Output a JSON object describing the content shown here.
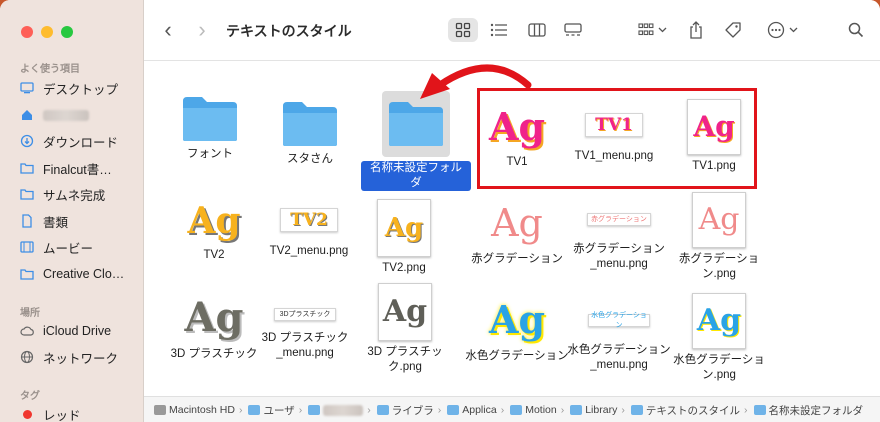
{
  "window": {
    "title": "テキストのスタイル"
  },
  "sidebar": {
    "favorites_title": "よく使う項目",
    "items": [
      {
        "label": "デスクトップ",
        "icon": "desktop-icon"
      },
      {
        "label": "",
        "icon": "home-icon"
      },
      {
        "label": "ダウンロード",
        "icon": "download-icon"
      },
      {
        "label": "Finalcut書…",
        "icon": "folder-icon"
      },
      {
        "label": "サムネ完成",
        "icon": "folder-icon"
      },
      {
        "label": "書類",
        "icon": "document-icon"
      },
      {
        "label": "ムービー",
        "icon": "movie-icon"
      },
      {
        "label": "Creative Clo…",
        "icon": "folder-icon"
      }
    ],
    "locations_title": "場所",
    "locations": [
      {
        "label": "iCloud Drive",
        "icon": "cloud-icon"
      },
      {
        "label": "ネットワーク",
        "icon": "globe-icon"
      }
    ],
    "tags_title": "タグ",
    "tags": [
      {
        "label": "レッド",
        "color": "#f0372f"
      }
    ]
  },
  "toolbar": {
    "back": "‹",
    "forward": "›",
    "view_selected": "icon-view"
  },
  "files": [
    {
      "name": "フォント",
      "kind": "folder"
    },
    {
      "name": "スタさん",
      "kind": "folder"
    },
    {
      "name": "名称未設定フォルダ",
      "kind": "folder",
      "selected": true
    },
    {
      "name": "TV1",
      "kind": "ag-pink"
    },
    {
      "name": "TV1_menu.png",
      "kind": "strip-tv1",
      "text": "TV1"
    },
    {
      "name": "TV1.png",
      "kind": "doc-pink"
    },
    {
      "name": "TV2",
      "kind": "ag-yellow"
    },
    {
      "name": "TV2_menu.png",
      "kind": "strip-tv2",
      "text": "TV2"
    },
    {
      "name": "TV2.png",
      "kind": "doc-yellow"
    },
    {
      "name": "赤グラデーション",
      "kind": "ag-red"
    },
    {
      "name": "赤グラデーション\n_menu.png",
      "kind": "strip-red",
      "text": "赤グラデーション"
    },
    {
      "name": "赤グラデーショ\nン.png",
      "kind": "doc-red"
    },
    {
      "name": "3D プラスチック",
      "kind": "ag-3d"
    },
    {
      "name": "3D プラスチック\n_menu.png",
      "kind": "strip-3d",
      "text": "3Dプラスチック"
    },
    {
      "name": "3D プラスチッ\nク.png",
      "kind": "doc-3d"
    },
    {
      "name": "水色グラデーション",
      "kind": "ag-blue"
    },
    {
      "name": "水色グラデーション\n_menu.png",
      "kind": "strip-blue",
      "text": "水色グラデーション"
    },
    {
      "name": "水色グラデーショ\nン.png",
      "kind": "doc-blue"
    }
  ],
  "thumb_glyph": "Ag",
  "pathbar": [
    "Macintosh HD",
    "ユーザ",
    "",
    "ライブラ",
    "Applica",
    "Motion",
    "Library",
    "テキストのスタイル",
    "名称未設定フォルダ"
  ],
  "colors": {
    "accent": "#2562d9",
    "highlight": "#e1141a",
    "folder": "#5bb2ec"
  }
}
